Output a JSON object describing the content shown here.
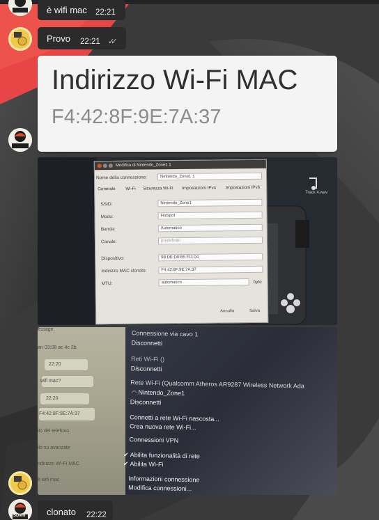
{
  "messages": [
    {
      "text": "è wifi mac",
      "time": "22:21"
    },
    {
      "text": "Provo",
      "time": "22:21",
      "ticks": "✓✓"
    },
    {
      "text": "clonato",
      "time": "22:22"
    }
  ],
  "card": {
    "heading": "Indirizzo Wi-Fi MAC",
    "mac": "F4:42:8F:9E:7A:37"
  },
  "avatar_label": "SDWII",
  "dialog": {
    "title": "Modifica di Nintendo_Zone1 1",
    "conn_name_label": "Nome della connessione:",
    "conn_name": "Nintendo_Zone1 1",
    "tabs": [
      "Generale",
      "Wi-Fi",
      "Sicurezza Wi-Fi",
      "Impostazioni IPv4",
      "Impostazioni IPv6"
    ],
    "fields": [
      {
        "label": "SSID:",
        "value": "Nintendo_Zone1"
      },
      {
        "label": "Modo:",
        "value": "Hotspot"
      },
      {
        "label": "Banda:",
        "value": "Automatico"
      },
      {
        "label": "Canale:",
        "value": "predefinito"
      },
      {
        "label": "Dispositivo:",
        "value": "98:DE:D0:B5:FD:D4"
      },
      {
        "label": "Indirizzo MAC clonato:",
        "value": "F4:42:8F:9E:7A:37"
      },
      {
        "label": "MTU:",
        "value": "automatico"
      }
    ],
    "mtu_unit": "byte",
    "cancel_label": "Annulla",
    "save_label": "Salva",
    "side_label": "Track 4.wav"
  },
  "network_menu": {
    "items": [
      {
        "text": "Connessione via cavo 1",
        "kind": "hd"
      },
      {
        "text": "Disconnetti",
        "kind": "item"
      },
      {
        "text": "Reti Wi-Fi ()",
        "kind": "hd"
      },
      {
        "text": "Disconnetti",
        "kind": "item"
      },
      {
        "text": "Rete Wi-Fi (Qualcomm Atheros AR9287 Wireless Network Ada",
        "kind": "hd"
      },
      {
        "text": "Nintendo_Zone1",
        "kind": "item"
      },
      {
        "text": "Disconnetti",
        "kind": "item"
      },
      {
        "text": "Connetti a rete Wi-Fi nascosta...",
        "kind": "item"
      },
      {
        "text": "Crea nuova rete Wi-Fi...",
        "kind": "item"
      },
      {
        "text": "Connessioni VPN",
        "kind": "item"
      },
      {
        "text": "✔ Abilita funzionalità di rete",
        "kind": "item"
      },
      {
        "text": "✔ Abilita Wi-Fi",
        "kind": "item"
      },
      {
        "text": "Informazioni connessione",
        "kind": "item"
      },
      {
        "text": "Modifica connessioni...",
        "kind": "item"
      }
    ],
    "side_texts": [
      "essage",
      "an 03:08 ac 4c 2b",
      "wifi mac?",
      "F4:42:8F:9E:7A:37",
      "ilo del telefono",
      "ilo su avanzate",
      "ndirizzo Wi-Fi MAC",
      "è wifi mac"
    ],
    "side_times": [
      "22:20",
      "22:20"
    ]
  },
  "colors": {
    "accent_red": "#e84040",
    "bubble": "#2b2b2c",
    "card": "#f4f4f4"
  }
}
